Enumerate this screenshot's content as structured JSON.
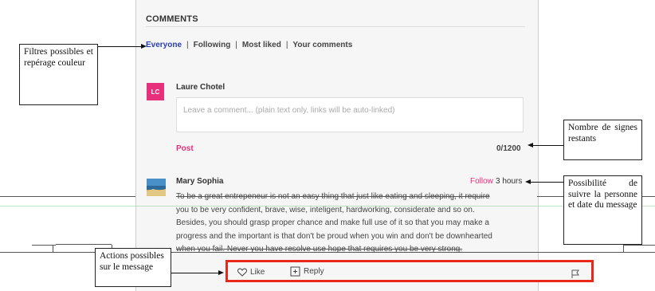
{
  "panel": {
    "title": "COMMENTS",
    "filters": [
      "Everyone",
      "|",
      "Following",
      "|",
      "Most liked",
      "|",
      "Your comments"
    ],
    "composer": {
      "avatar_initials": "LC",
      "author": "Laure Chotel",
      "placeholder": "Leave a comment... (plain text only, links will be auto-linked)",
      "post_label": "Post",
      "char_count": "0/1200"
    },
    "comment": {
      "author": "Mary Sophia",
      "follow_label": "Follow",
      "time": "3 hours",
      "lines": [
        "To be a great entrepeneur is not an easy thing that just like eating and sleeping, it require",
        "you to be very confident, brave, wise, inteligent, hardworking, considerate and so on.",
        "Besides, you should grasp proper chance and make full use of it so that you may make a",
        "progress and the important is that don't be proud when you win and don't be downhearted",
        "when you fail. Never you have resolve use hope that requires you be very strong."
      ],
      "actions": {
        "like": "Like",
        "reply": "Reply"
      }
    }
  },
  "annotations": {
    "filters": "Filtres possibles et repérage couleur",
    "counter": "Nombre de signes restants",
    "follow": "Possibilité de suivre la personne et date du message",
    "actions": "Actions possibles sur le message"
  },
  "colors": {
    "accent_pink": "#e6307b",
    "active_blue": "#2a3fb6",
    "highlight_red": "#e8281d"
  }
}
